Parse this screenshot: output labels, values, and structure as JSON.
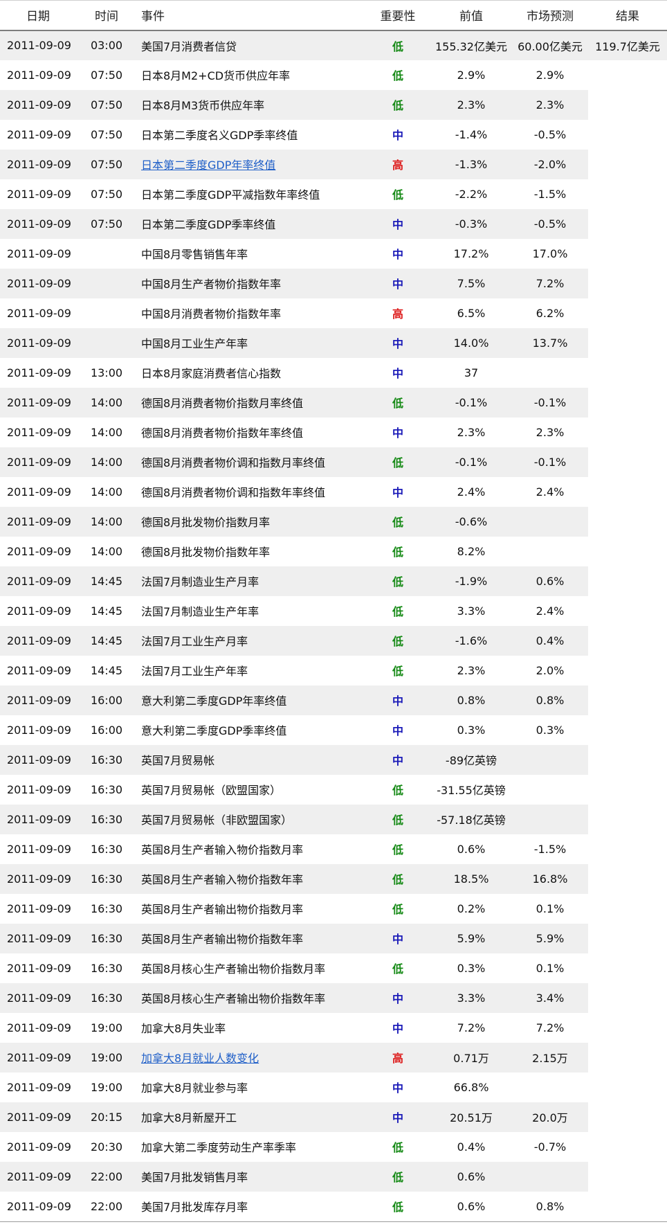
{
  "headers": {
    "date": "日期",
    "time": "时间",
    "event": "事件",
    "importance": "重要性",
    "previous": "前值",
    "forecast": "市场预测",
    "result": "结果"
  },
  "importance_colors": {
    "低": "#168a16",
    "中": "#1a1ab8",
    "高": "#dd1b1b"
  },
  "rows": [
    {
      "date": "2011-09-09",
      "time": "03:00",
      "event": "美国7月消费者信贷",
      "importance": "低",
      "previous": "155.32亿美元",
      "forecast": "60.00亿美元",
      "result": "119.7亿美元",
      "link": false
    },
    {
      "date": "2011-09-09",
      "time": "07:50",
      "event": "日本8月M2+CD货币供应年率",
      "importance": "低",
      "previous": "2.9%",
      "forecast": "2.9%",
      "result": "",
      "link": false
    },
    {
      "date": "2011-09-09",
      "time": "07:50",
      "event": "日本8月M3货币供应年率",
      "importance": "低",
      "previous": "2.3%",
      "forecast": "2.3%",
      "result": "",
      "link": false
    },
    {
      "date": "2011-09-09",
      "time": "07:50",
      "event": "日本第二季度名义GDP季率终值",
      "importance": "中",
      "previous": "-1.4%",
      "forecast": "-0.5%",
      "result": "",
      "link": false
    },
    {
      "date": "2011-09-09",
      "time": "07:50",
      "event": "日本第二季度GDP年率终值",
      "importance": "高",
      "previous": "-1.3%",
      "forecast": "-2.0%",
      "result": "",
      "link": true
    },
    {
      "date": "2011-09-09",
      "time": "07:50",
      "event": "日本第二季度GDP平减指数年率终值",
      "importance": "低",
      "previous": "-2.2%",
      "forecast": "-1.5%",
      "result": "",
      "link": false
    },
    {
      "date": "2011-09-09",
      "time": "07:50",
      "event": "日本第二季度GDP季率终值",
      "importance": "中",
      "previous": "-0.3%",
      "forecast": "-0.5%",
      "result": "",
      "link": false
    },
    {
      "date": "2011-09-09",
      "time": "",
      "event": "中国8月零售销售年率",
      "importance": "中",
      "previous": "17.2%",
      "forecast": "17.0%",
      "result": "",
      "link": false
    },
    {
      "date": "2011-09-09",
      "time": "",
      "event": "中国8月生产者物价指数年率",
      "importance": "中",
      "previous": "7.5%",
      "forecast": "7.2%",
      "result": "",
      "link": false
    },
    {
      "date": "2011-09-09",
      "time": "",
      "event": "中国8月消费者物价指数年率",
      "importance": "高",
      "previous": "6.5%",
      "forecast": "6.2%",
      "result": "",
      "link": false
    },
    {
      "date": "2011-09-09",
      "time": "",
      "event": "中国8月工业生产年率",
      "importance": "中",
      "previous": "14.0%",
      "forecast": "13.7%",
      "result": "",
      "link": false
    },
    {
      "date": "2011-09-09",
      "time": "13:00",
      "event": "日本8月家庭消费者信心指数",
      "importance": "中",
      "previous": "37",
      "forecast": "",
      "result": "",
      "link": false
    },
    {
      "date": "2011-09-09",
      "time": "14:00",
      "event": "德国8月消费者物价指数月率终值",
      "importance": "低",
      "previous": "-0.1%",
      "forecast": "-0.1%",
      "result": "",
      "link": false
    },
    {
      "date": "2011-09-09",
      "time": "14:00",
      "event": "德国8月消费者物价指数年率终值",
      "importance": "中",
      "previous": "2.3%",
      "forecast": "2.3%",
      "result": "",
      "link": false
    },
    {
      "date": "2011-09-09",
      "time": "14:00",
      "event": "德国8月消费者物价调和指数月率终值",
      "importance": "低",
      "previous": "-0.1%",
      "forecast": "-0.1%",
      "result": "",
      "link": false
    },
    {
      "date": "2011-09-09",
      "time": "14:00",
      "event": "德国8月消费者物价调和指数年率终值",
      "importance": "中",
      "previous": "2.4%",
      "forecast": "2.4%",
      "result": "",
      "link": false
    },
    {
      "date": "2011-09-09",
      "time": "14:00",
      "event": "德国8月批发物价指数月率",
      "importance": "低",
      "previous": "-0.6%",
      "forecast": "",
      "result": "",
      "link": false
    },
    {
      "date": "2011-09-09",
      "time": "14:00",
      "event": "德国8月批发物价指数年率",
      "importance": "低",
      "previous": "8.2%",
      "forecast": "",
      "result": "",
      "link": false
    },
    {
      "date": "2011-09-09",
      "time": "14:45",
      "event": "法国7月制造业生产月率",
      "importance": "低",
      "previous": "-1.9%",
      "forecast": "0.6%",
      "result": "",
      "link": false
    },
    {
      "date": "2011-09-09",
      "time": "14:45",
      "event": "法国7月制造业生产年率",
      "importance": "低",
      "previous": "3.3%",
      "forecast": "2.4%",
      "result": "",
      "link": false
    },
    {
      "date": "2011-09-09",
      "time": "14:45",
      "event": "法国7月工业生产月率",
      "importance": "低",
      "previous": "-1.6%",
      "forecast": "0.4%",
      "result": "",
      "link": false
    },
    {
      "date": "2011-09-09",
      "time": "14:45",
      "event": "法国7月工业生产年率",
      "importance": "低",
      "previous": "2.3%",
      "forecast": "2.0%",
      "result": "",
      "link": false
    },
    {
      "date": "2011-09-09",
      "time": "16:00",
      "event": "意大利第二季度GDP年率终值",
      "importance": "中",
      "previous": "0.8%",
      "forecast": "0.8%",
      "result": "",
      "link": false
    },
    {
      "date": "2011-09-09",
      "time": "16:00",
      "event": "意大利第二季度GDP季率终值",
      "importance": "中",
      "previous": "0.3%",
      "forecast": "0.3%",
      "result": "",
      "link": false
    },
    {
      "date": "2011-09-09",
      "time": "16:30",
      "event": "英国7月贸易帐",
      "importance": "中",
      "previous": "-89亿英镑",
      "forecast": "",
      "result": "",
      "link": false
    },
    {
      "date": "2011-09-09",
      "time": "16:30",
      "event": "英国7月贸易帐（欧盟国家）",
      "importance": "低",
      "previous": "-31.55亿英镑",
      "forecast": "",
      "result": "",
      "link": false
    },
    {
      "date": "2011-09-09",
      "time": "16:30",
      "event": "英国7月贸易帐（非欧盟国家）",
      "importance": "低",
      "previous": "-57.18亿英镑",
      "forecast": "",
      "result": "",
      "link": false
    },
    {
      "date": "2011-09-09",
      "time": "16:30",
      "event": "英国8月生产者输入物价指数月率",
      "importance": "低",
      "previous": "0.6%",
      "forecast": "-1.5%",
      "result": "",
      "link": false
    },
    {
      "date": "2011-09-09",
      "time": "16:30",
      "event": "英国8月生产者输入物价指数年率",
      "importance": "低",
      "previous": "18.5%",
      "forecast": "16.8%",
      "result": "",
      "link": false
    },
    {
      "date": "2011-09-09",
      "time": "16:30",
      "event": "英国8月生产者输出物价指数月率",
      "importance": "低",
      "previous": "0.2%",
      "forecast": "0.1%",
      "result": "",
      "link": false
    },
    {
      "date": "2011-09-09",
      "time": "16:30",
      "event": "英国8月生产者输出物价指数年率",
      "importance": "中",
      "previous": "5.9%",
      "forecast": "5.9%",
      "result": "",
      "link": false
    },
    {
      "date": "2011-09-09",
      "time": "16:30",
      "event": "英国8月核心生产者输出物价指数月率",
      "importance": "低",
      "previous": "0.3%",
      "forecast": "0.1%",
      "result": "",
      "link": false
    },
    {
      "date": "2011-09-09",
      "time": "16:30",
      "event": "英国8月核心生产者输出物价指数年率",
      "importance": "中",
      "previous": "3.3%",
      "forecast": "3.4%",
      "result": "",
      "link": false
    },
    {
      "date": "2011-09-09",
      "time": "19:00",
      "event": "加拿大8月失业率",
      "importance": "中",
      "previous": "7.2%",
      "forecast": "7.2%",
      "result": "",
      "link": false
    },
    {
      "date": "2011-09-09",
      "time": "19:00",
      "event": "加拿大8月就业人数变化",
      "importance": "高",
      "previous": "0.71万",
      "forecast": "2.15万",
      "result": "",
      "link": true
    },
    {
      "date": "2011-09-09",
      "time": "19:00",
      "event": "加拿大8月就业参与率",
      "importance": "中",
      "previous": "66.8%",
      "forecast": "",
      "result": "",
      "link": false
    },
    {
      "date": "2011-09-09",
      "time": "20:15",
      "event": "加拿大8月新屋开工",
      "importance": "中",
      "previous": "20.51万",
      "forecast": "20.0万",
      "result": "",
      "link": false
    },
    {
      "date": "2011-09-09",
      "time": "20:30",
      "event": "加拿大第二季度劳动生产率季率",
      "importance": "低",
      "previous": "0.4%",
      "forecast": "-0.7%",
      "result": "",
      "link": false
    },
    {
      "date": "2011-09-09",
      "time": "22:00",
      "event": "美国7月批发销售月率",
      "importance": "低",
      "previous": "0.6%",
      "forecast": "",
      "result": "",
      "link": false
    },
    {
      "date": "2011-09-09",
      "time": "22:00",
      "event": "美国7月批发库存月率",
      "importance": "低",
      "previous": "0.6%",
      "forecast": "0.8%",
      "result": "",
      "link": false
    }
  ]
}
